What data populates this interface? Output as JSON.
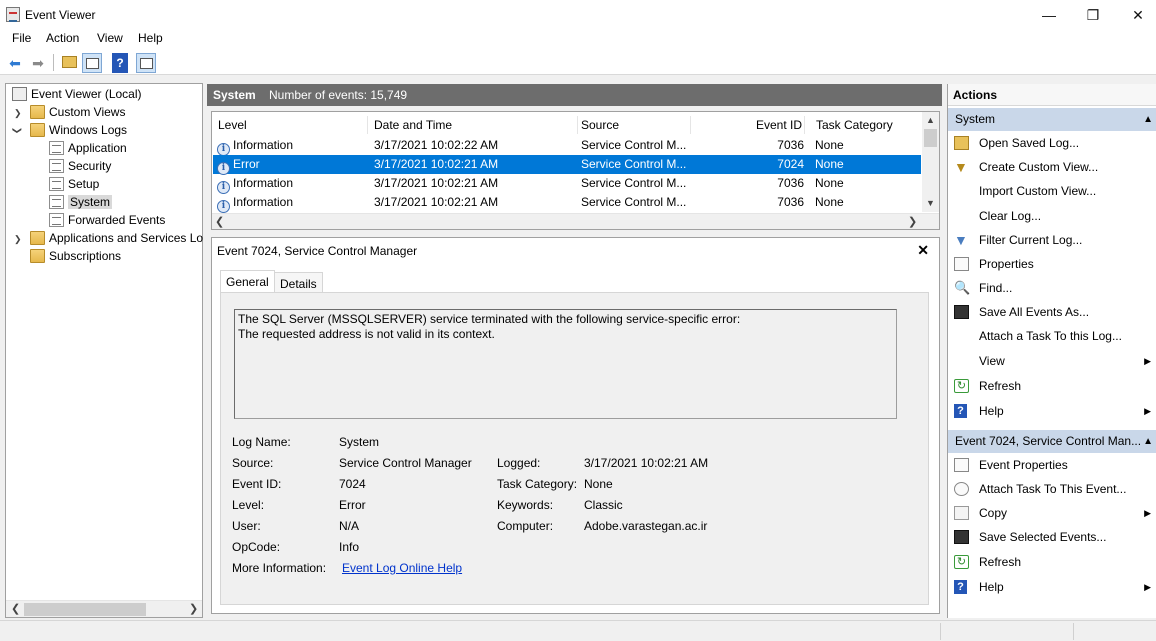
{
  "window": {
    "title": "Event Viewer",
    "minimize": "—",
    "maximize": "❐",
    "close": "✕"
  },
  "menu": [
    "File",
    "Action",
    "View",
    "Help"
  ],
  "toolbar": {
    "icons": [
      "back-arrow-icon",
      "forward-arrow-icon",
      "open-folder-icon",
      "show-hide-tree-icon",
      "help-icon",
      "show-hide-action-pane-icon"
    ]
  },
  "tree": {
    "root": "Event Viewer (Local)",
    "custom_views": "Custom Views",
    "windows_logs": "Windows Logs",
    "logs": [
      "Application",
      "Security",
      "Setup",
      "System",
      "Forwarded Events"
    ],
    "apps_services": "Applications and Services Lo",
    "subscriptions": "Subscriptions"
  },
  "middle": {
    "log_name": "System",
    "count_text": "Number of events: 15,749",
    "columns": [
      "Level",
      "Date and Time",
      "Source",
      "Event ID",
      "Task Category"
    ],
    "rows": [
      {
        "level": "Information",
        "date": "3/17/2021 10:02:22 AM",
        "source": "Service Control M...",
        "id": "7036",
        "task": "None",
        "selected": false
      },
      {
        "level": "Error",
        "date": "3/17/2021 10:02:21 AM",
        "source": "Service Control M...",
        "id": "7024",
        "task": "None",
        "selected": true
      },
      {
        "level": "Information",
        "date": "3/17/2021 10:02:21 AM",
        "source": "Service Control M...",
        "id": "7036",
        "task": "None",
        "selected": false
      },
      {
        "level": "Information",
        "date": "3/17/2021 10:02:21 AM",
        "source": "Service Control M...",
        "id": "7036",
        "task": "None",
        "selected": false
      }
    ]
  },
  "detail": {
    "title": "Event 7024, Service Control Manager",
    "tabs": [
      "General",
      "Details"
    ],
    "desc_line1": "The SQL Server (MSSQLSERVER) service terminated with the following service-specific error:",
    "desc_line2": "The requested address is not valid in its context.",
    "fields": {
      "log_name_label": "Log Name:",
      "log_name": "System",
      "source_label": "Source:",
      "source": "Service Control Manager",
      "logged_label": "Logged:",
      "logged": "3/17/2021 10:02:21 AM",
      "event_id_label": "Event ID:",
      "event_id": "7024",
      "task_label": "Task Category:",
      "task": "None",
      "level_label": "Level:",
      "level": "Error",
      "keywords_label": "Keywords:",
      "keywords": "Classic",
      "user_label": "User:",
      "user": "N/A",
      "computer_label": "Computer:",
      "computer": "Adobe.varastegan.ac.ir",
      "opcode_label": "OpCode:",
      "opcode": "Info",
      "more_label": "More Information:",
      "more_link": "Event Log Online Help"
    }
  },
  "actions": {
    "title": "Actions",
    "section1": "System",
    "items1": [
      {
        "label": "Open Saved Log...",
        "icon": "open-folder-icon"
      },
      {
        "label": "Create Custom View...",
        "icon": "filter-icon"
      },
      {
        "label": "Import Custom View...",
        "icon": ""
      },
      {
        "label": "Clear Log...",
        "icon": ""
      },
      {
        "label": "Filter Current Log...",
        "icon": "filter-icon"
      },
      {
        "label": "Properties",
        "icon": "properties-icon"
      },
      {
        "label": "Find...",
        "icon": "find-icon"
      },
      {
        "label": "Save All Events As...",
        "icon": "save-icon"
      },
      {
        "label": "Attach a Task To this Log...",
        "icon": ""
      },
      {
        "label": "View",
        "icon": "",
        "submenu": true
      },
      {
        "label": "Refresh",
        "icon": "refresh-icon"
      },
      {
        "label": "Help",
        "icon": "help-icon",
        "submenu": true
      }
    ],
    "section2": "Event 7024, Service Control Man...",
    "items2": [
      {
        "label": "Event Properties",
        "icon": "properties-icon"
      },
      {
        "label": "Attach Task To This Event...",
        "icon": "task-clock-icon"
      },
      {
        "label": "Copy",
        "icon": "copy-icon",
        "submenu": true
      },
      {
        "label": "Save Selected Events...",
        "icon": "save-icon"
      },
      {
        "label": "Refresh",
        "icon": "refresh-icon"
      },
      {
        "label": "Help",
        "icon": "help-icon",
        "submenu": true
      }
    ]
  }
}
